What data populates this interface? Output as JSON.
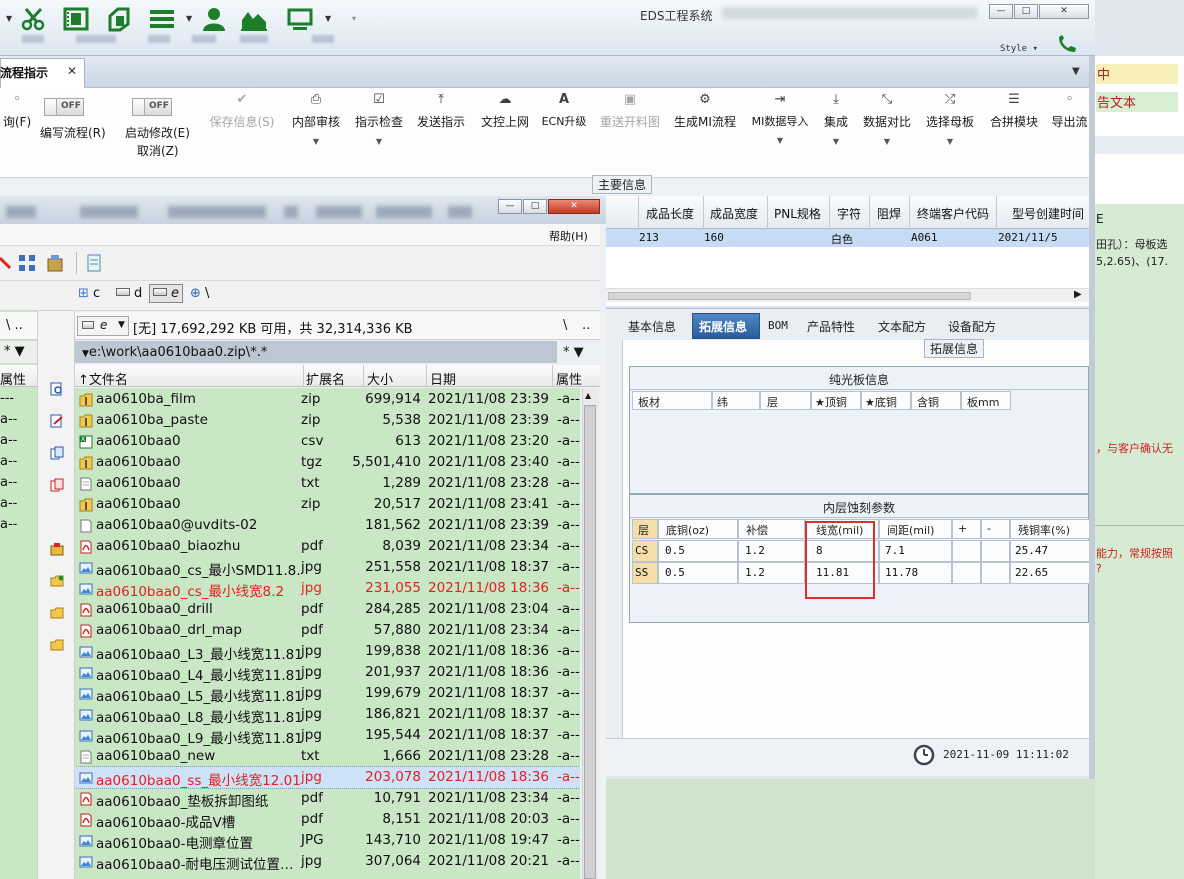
{
  "app": {
    "title": "EDS工程系统",
    "style_label": "Style",
    "window_controls": [
      "—",
      "□",
      "✕"
    ]
  },
  "quick_toolbar": {
    "icons": [
      "scissors-icon",
      "film-icon",
      "copy-icon",
      "list-icon",
      "user-icon",
      "chart-icon",
      "monitor-icon"
    ]
  },
  "tab": {
    "label": "流程指示",
    "close": "✕"
  },
  "ribbon": {
    "query_label": "询(F)",
    "write_flow": {
      "toggle": "OFF",
      "label": "编写流程(R)"
    },
    "start_modify": {
      "toggle": "OFF",
      "label": "启动修改(E)",
      "sublabel": "取消(Z)"
    },
    "save_info": "保存信息(S)",
    "buttons": [
      {
        "label": "内部审核",
        "dropdown": true
      },
      {
        "label": "指示检查",
        "dropdown": true
      },
      {
        "label": "发送指示",
        "dropdown": false
      },
      {
        "label": "文控上网",
        "dropdown": false
      },
      {
        "label": "ECN升级",
        "dropdown": false
      },
      {
        "label": "重送开料图",
        "dropdown": false
      },
      {
        "label": "生成MI流程",
        "dropdown": false
      },
      {
        "label": "MI数据导入",
        "dropdown": true
      },
      {
        "label": "集成",
        "dropdown": true
      },
      {
        "label": "数据对比",
        "dropdown": true
      },
      {
        "label": "选择母板",
        "dropdown": true
      },
      {
        "label": "合拼模块",
        "dropdown": false
      },
      {
        "label": "导出流",
        "dropdown": false
      }
    ],
    "group_label": "主要信息"
  },
  "product_grid": {
    "headers": [
      "成品长度",
      "成品宽度",
      "PNL规格",
      "字符",
      "阻焊",
      "终端客户代码",
      "型号创建时间"
    ],
    "row": {
      "length": "213",
      "width": "160",
      "pnl": "",
      "char": "白色",
      "mask": "",
      "client": "A061",
      "created": "2021/11/5"
    }
  },
  "detail": {
    "tabs": [
      "基本信息",
      "拓展信息",
      "BOM",
      "产品特性",
      "文本配方",
      "设备配方"
    ],
    "active_tab": "拓展信息",
    "section_label": "拓展信息",
    "bare_board": {
      "title": "纯光板信息",
      "headers": [
        "板材",
        "纬",
        "层",
        "★顶铜",
        "★底铜",
        "含铜",
        "板mm"
      ]
    },
    "inner_etch": {
      "title": "内层蚀刻参数",
      "headers": [
        "层",
        "底铜(oz)",
        "补偿",
        "线宽(mil)",
        "间距(mil)",
        "+",
        "-",
        "残铜率(%)"
      ],
      "rows": [
        {
          "layer": "CS",
          "base": "0.5",
          "comp": "1.2",
          "width": "8",
          "spacing": "7.1",
          "plus": "",
          "minus": "",
          "residual": "25.47"
        },
        {
          "layer": "SS",
          "base": "0.5",
          "comp": "1.2",
          "width": "11.81",
          "spacing": "11.78",
          "plus": "",
          "minus": "",
          "residual": "22.65"
        }
      ]
    },
    "status_time": "2021-11-09 11:11:02"
  },
  "right_fragment": {
    "tag_yellow": "中",
    "tag_green": "告文本",
    "col_label": "E",
    "line1": "田孔）：母板选",
    "line2": "5,2.65)、(17.",
    "line3": "，与客户确认无",
    "line4": "能力，常规按照",
    "line5": "?"
  },
  "file_manager": {
    "help_menu": "帮助(H)",
    "drives": [
      "c",
      "d",
      "e",
      "\\"
    ],
    "current_drive": "e",
    "free_space": "[无]  17,692,292 KB 可用，共 32,314,336 KB",
    "path": "e:\\work\\aa0610baa0.zip\\*.*",
    "nav_up": "\\",
    "nav_dots": "..",
    "filter": "*",
    "columns": {
      "name": "文件名",
      "ext": "扩展名",
      "size": "大小",
      "date": "日期",
      "attr": "属性"
    },
    "left_pane": {
      "nav": "\\  ..",
      "filter": "*",
      "attr_header": "属性",
      "rows": [
        "---",
        "a--",
        "a--",
        "a--",
        "a--",
        "a--",
        "a--"
      ]
    },
    "files": [
      {
        "name": "aa0610ba_film",
        "ext": "zip",
        "size": "699,914",
        "date": "2021/11/08 23:39",
        "attr": "-a--",
        "icon": "folder-zip-icon",
        "style": "normal"
      },
      {
        "name": "aa0610ba_paste",
        "ext": "zip",
        "size": "5,538",
        "date": "2021/11/08 23:39",
        "attr": "-a--",
        "icon": "folder-zip-icon",
        "style": "normal"
      },
      {
        "name": "aa0610baa0",
        "ext": "csv",
        "size": "613",
        "date": "2021/11/08 23:20",
        "attr": "-a--",
        "icon": "spreadsheet-icon",
        "style": "normal"
      },
      {
        "name": "aa0610baa0",
        "ext": "tgz",
        "size": "5,501,410",
        "date": "2021/11/08 23:40",
        "attr": "-a--",
        "icon": "folder-zip-icon",
        "style": "normal"
      },
      {
        "name": "aa0610baa0",
        "ext": "txt",
        "size": "1,289",
        "date": "2021/11/08 23:28",
        "attr": "-a--",
        "icon": "text-file-icon",
        "style": "normal"
      },
      {
        "name": "aa0610baa0",
        "ext": "zip",
        "size": "20,517",
        "date": "2021/11/08 23:41",
        "attr": "-a--",
        "icon": "folder-zip-icon",
        "style": "normal"
      },
      {
        "name": "aa0610baa0@uvdits-02",
        "ext": "",
        "size": "181,562",
        "date": "2021/11/08 23:39",
        "attr": "-a--",
        "icon": "file-icon",
        "style": "normal"
      },
      {
        "name": "aa0610baa0_biaozhu",
        "ext": "pdf",
        "size": "8,039",
        "date": "2021/11/08 23:34",
        "attr": "-a--",
        "icon": "pdf-icon",
        "style": "normal"
      },
      {
        "name": "aa0610baa0_cs_最小SMD11.8…",
        "ext": "jpg",
        "size": "251,558",
        "date": "2021/11/08 18:37",
        "attr": "-a--",
        "icon": "image-icon",
        "style": "normal"
      },
      {
        "name": "aa0610baa0_cs_最小线宽8.2",
        "ext": "jpg",
        "size": "231,055",
        "date": "2021/11/08 18:36",
        "attr": "-a--",
        "icon": "image-icon",
        "style": "red"
      },
      {
        "name": "aa0610baa0_drill",
        "ext": "pdf",
        "size": "284,285",
        "date": "2021/11/08 23:04",
        "attr": "-a--",
        "icon": "pdf-icon",
        "style": "normal"
      },
      {
        "name": "aa0610baa0_drl_map",
        "ext": "pdf",
        "size": "57,880",
        "date": "2021/11/08 23:34",
        "attr": "-a--",
        "icon": "pdf-icon",
        "style": "normal"
      },
      {
        "name": "aa0610baa0_L3_最小线宽11.81",
        "ext": "jpg",
        "size": "199,838",
        "date": "2021/11/08 18:36",
        "attr": "-a--",
        "icon": "image-icon",
        "style": "normal"
      },
      {
        "name": "aa0610baa0_L4_最小线宽11.81",
        "ext": "jpg",
        "size": "201,937",
        "date": "2021/11/08 18:36",
        "attr": "-a--",
        "icon": "image-icon",
        "style": "normal"
      },
      {
        "name": "aa0610baa0_L5_最小线宽11.81",
        "ext": "jpg",
        "size": "199,679",
        "date": "2021/11/08 18:37",
        "attr": "-a--",
        "icon": "image-icon",
        "style": "normal"
      },
      {
        "name": "aa0610baa0_L8_最小线宽11.81",
        "ext": "jpg",
        "size": "186,821",
        "date": "2021/11/08 18:37",
        "attr": "-a--",
        "icon": "image-icon",
        "style": "normal"
      },
      {
        "name": "aa0610baa0_L9_最小线宽11.81",
        "ext": "jpg",
        "size": "195,544",
        "date": "2021/11/08 18:37",
        "attr": "-a--",
        "icon": "image-icon",
        "style": "normal"
      },
      {
        "name": "aa0610baa0_new",
        "ext": "txt",
        "size": "1,666",
        "date": "2021/11/08 23:28",
        "attr": "-a--",
        "icon": "text-file-icon",
        "style": "normal"
      },
      {
        "name": "aa0610baa0_ss_最小线宽12.01",
        "ext": "jpg",
        "size": "203,078",
        "date": "2021/11/08 18:36",
        "attr": "-a--",
        "icon": "image-icon",
        "style": "red-selected"
      },
      {
        "name": "aa0610baa0_垫板拆卸图纸",
        "ext": "pdf",
        "size": "10,791",
        "date": "2021/11/08 23:34",
        "attr": "-a--",
        "icon": "pdf-icon",
        "style": "normal"
      },
      {
        "name": "aa0610baa0-成品V槽",
        "ext": "pdf",
        "size": "8,151",
        "date": "2021/11/08 20:03",
        "attr": "-a--",
        "icon": "pdf-icon",
        "style": "normal"
      },
      {
        "name": "aa0610baa0-电测章位置",
        "ext": "JPG",
        "size": "143,710",
        "date": "2021/11/08 19:47",
        "attr": "-a--",
        "icon": "image-icon",
        "style": "normal"
      },
      {
        "name": "aa0610baa0-耐电压测试位置…",
        "ext": "jpg",
        "size": "307,064",
        "date": "2021/11/08 20:21",
        "attr": "-a--",
        "icon": "image-icon",
        "style": "normal"
      }
    ]
  }
}
